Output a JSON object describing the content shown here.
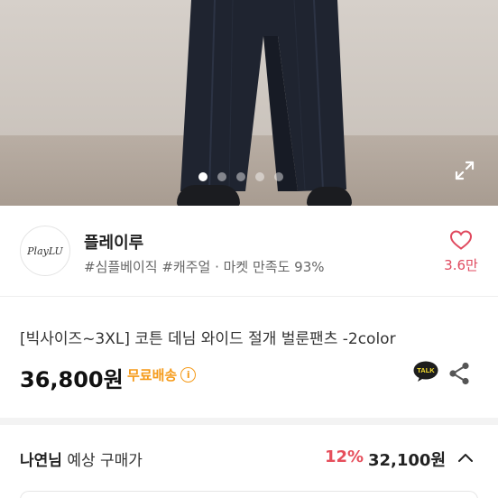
{
  "hero": {
    "image": "product-photo-wide-denim-pants",
    "slide_count": 5,
    "active_slide": 1,
    "expand_icon": "expand-icon"
  },
  "seller": {
    "logo_text": "PlayLU",
    "name": "플레이루",
    "tags": "#심플베이직 #캐주얼 · 마켓 만족도 93%",
    "likes": "3.6만",
    "heart_icon": "heart-outline-icon"
  },
  "product": {
    "title": "[빅사이즈~3XL] 코튼 데님 와이드 절개 벌룬팬츠 -2color",
    "price": "36,800원",
    "shipping": "무료배송",
    "info_icon_glyph": "i",
    "talk_icon": "kakaotalk-icon",
    "talk_label": "TALK",
    "share_icon": "share-icon"
  },
  "expected": {
    "buyer_name": "나연님",
    "label": " 예상 구매가",
    "discount": "12%",
    "final_price": "32,100원",
    "chevron": "chevron-up-icon"
  },
  "colors": {
    "accent_red": "#e64f5c",
    "shipping_orange": "#f59b1a",
    "heart_pink": "#e04a5f"
  }
}
